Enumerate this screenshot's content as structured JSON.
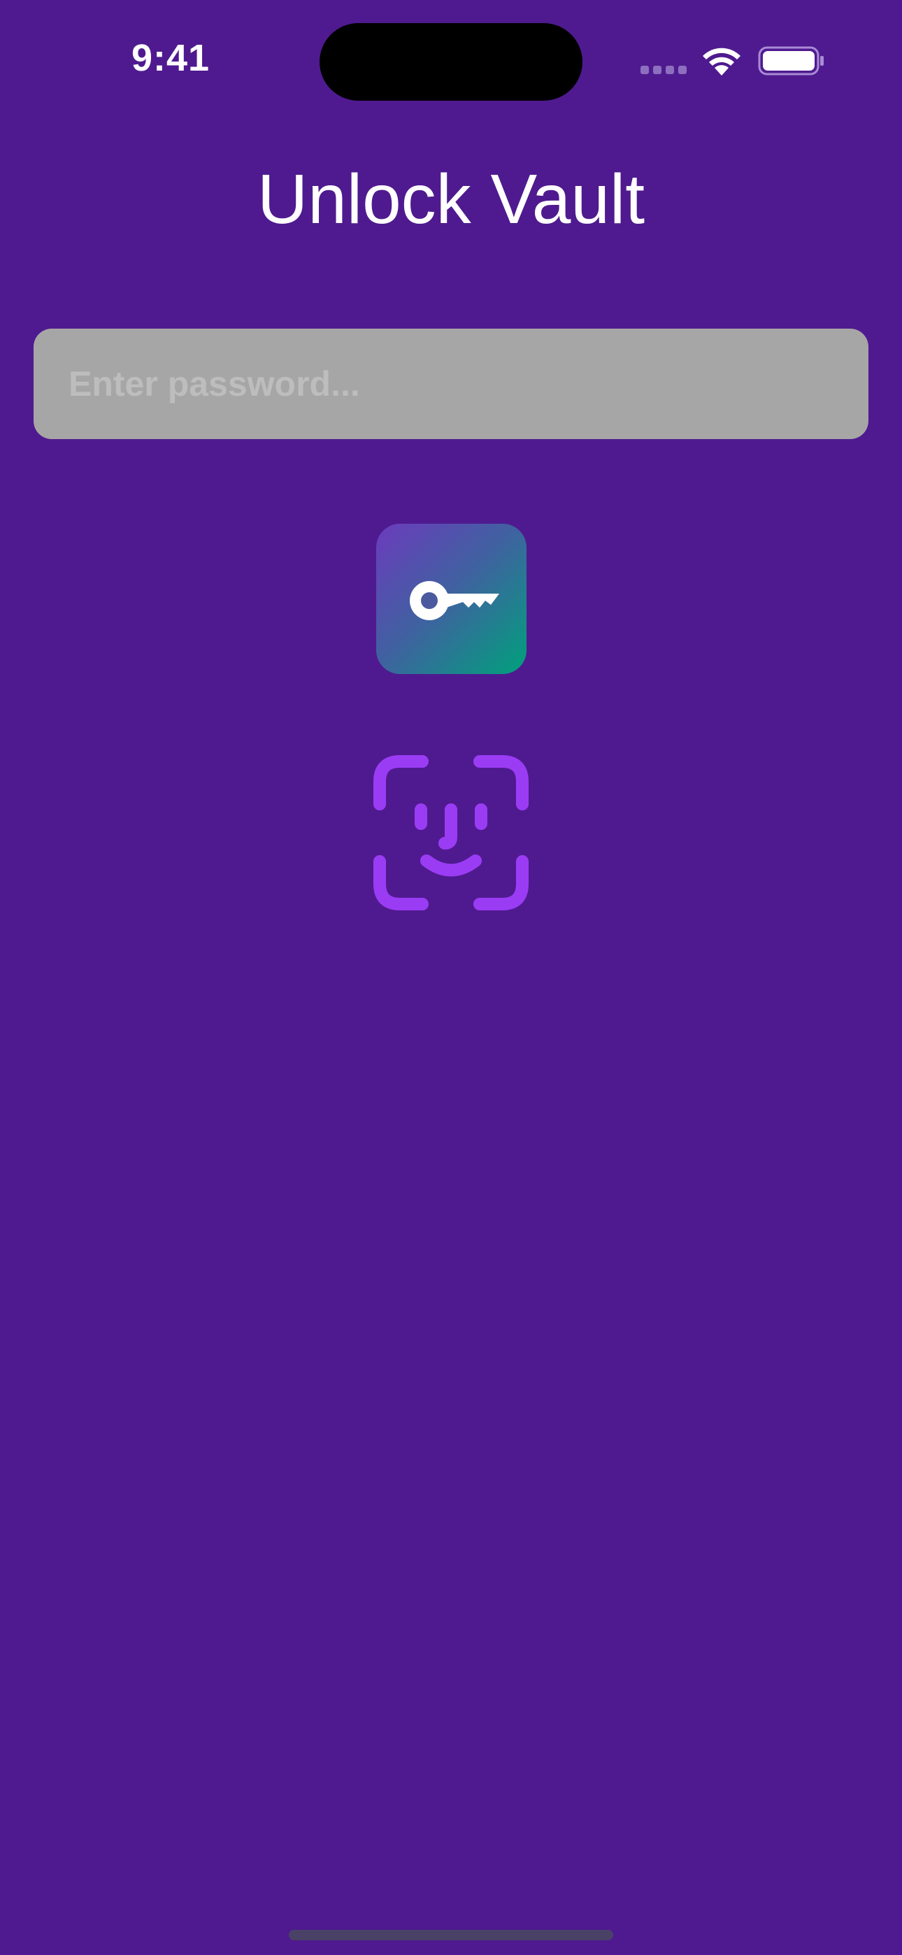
{
  "status_bar": {
    "time": "9:41"
  },
  "header": {
    "title": "Unlock Vault"
  },
  "password": {
    "value": "",
    "placeholder": "Enter password..."
  },
  "actions": {
    "key_button_icon": "key-icon",
    "faceid_button_icon": "face-id-icon"
  },
  "colors": {
    "background": "#4f1a8f",
    "field_background": "#a6a6a6",
    "placeholder_text": "#bdbdbd",
    "key_gradient_start": "#6c3bbd",
    "key_gradient_end": "#00a17c",
    "faceid_accent": "#9b3cf5"
  }
}
